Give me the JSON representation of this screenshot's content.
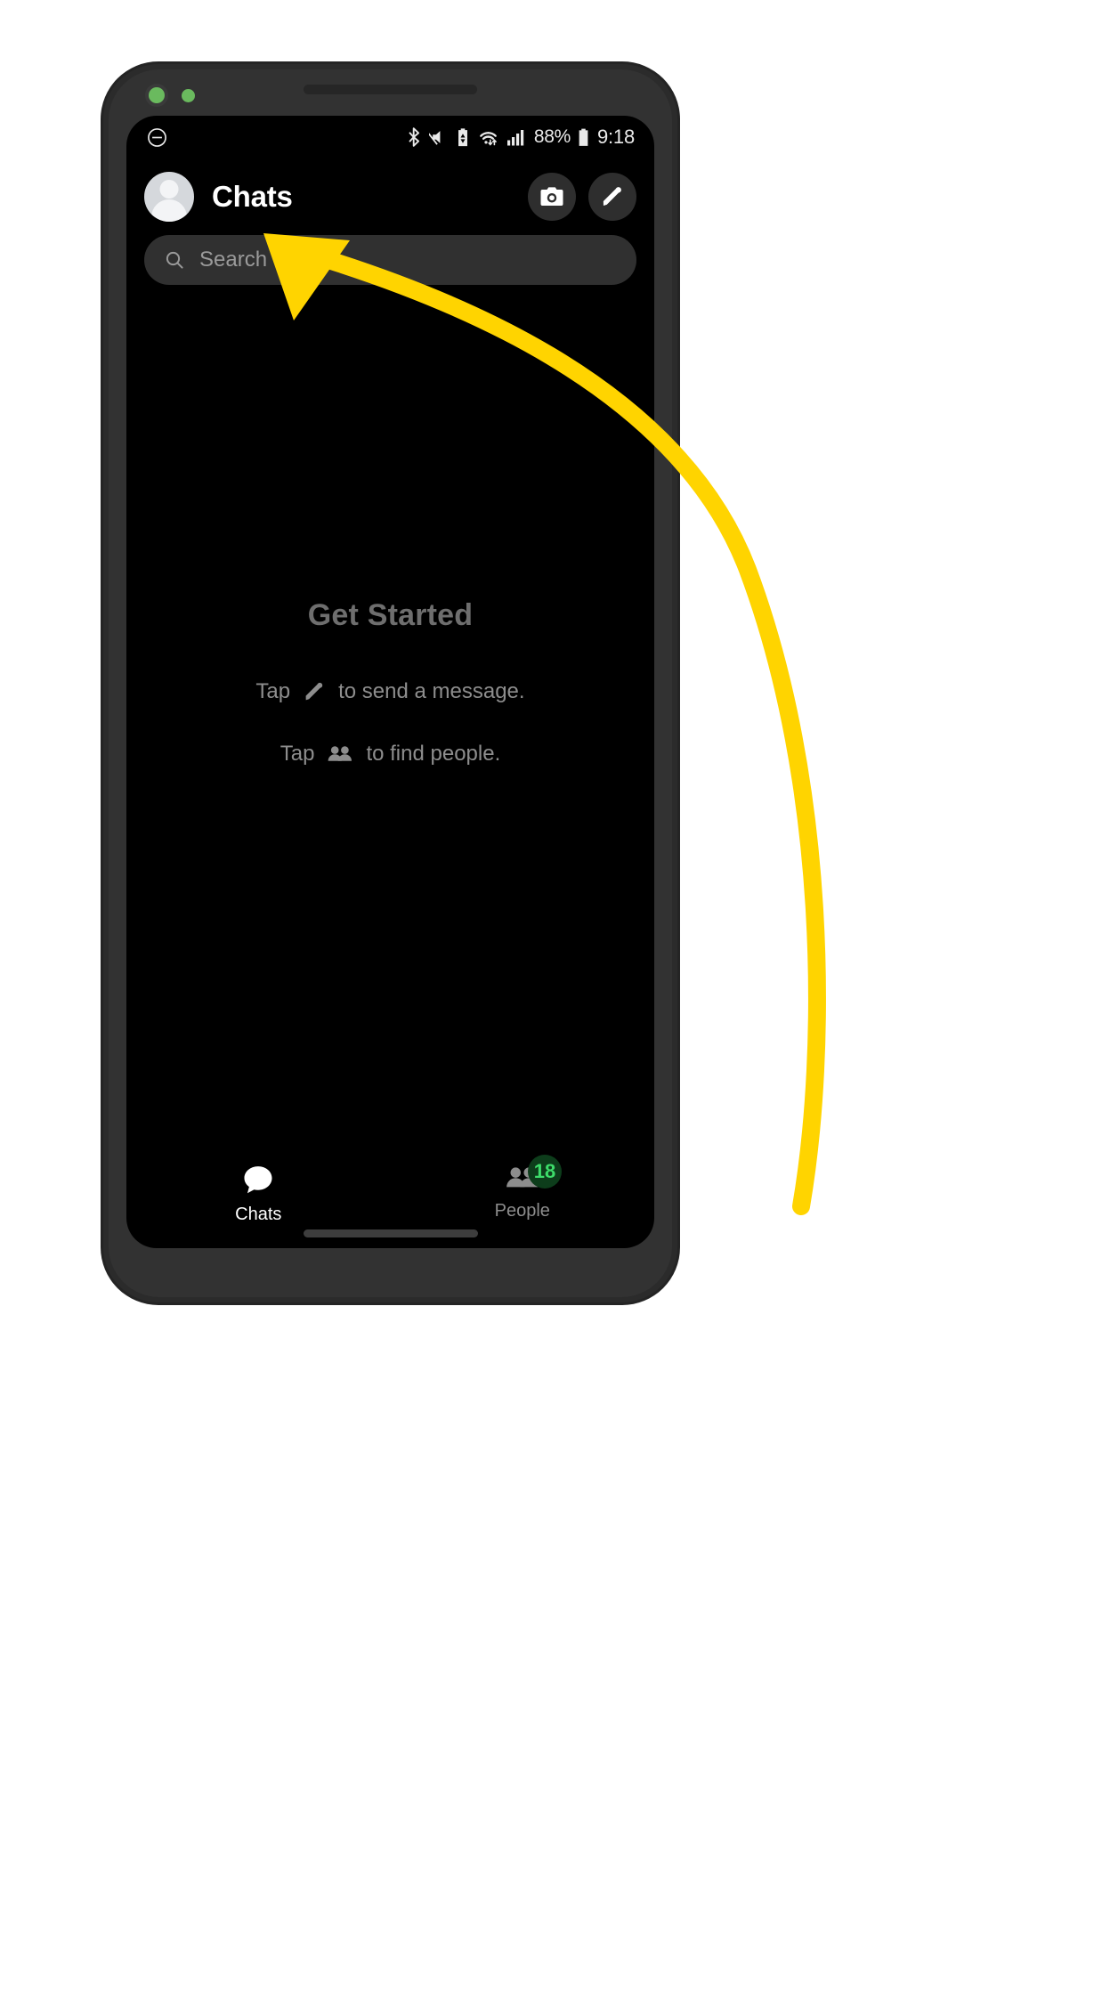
{
  "app": {
    "title": "Chats"
  },
  "status_bar": {
    "dnd_icon": "do-not-disturb-icon",
    "bluetooth_icon": "bluetooth-icon",
    "mute_icon": "volume-off-icon",
    "battery_saver_icon": "battery-saver-icon",
    "wifi_icon": "wifi-data-icon",
    "signal_icon": "cell-signal-icon",
    "battery_percent": "88%",
    "battery_icon": "battery-full-icon",
    "time": "9:18"
  },
  "header": {
    "avatar_name": "profile-avatar",
    "camera_label": "camera-icon",
    "compose_label": "compose-pencil-icon"
  },
  "search": {
    "placeholder": "Search",
    "icon": "search-icon"
  },
  "empty_state": {
    "title": "Get Started",
    "line1_before": "Tap",
    "line1_icon": "pencil-icon",
    "line1_after": "to send a message.",
    "line2_before": "Tap",
    "line2_icon": "people-icon",
    "line2_after": "to find people."
  },
  "bottom_nav": {
    "items": [
      {
        "label": "Chats",
        "icon": "chat-bubble-icon",
        "active": true,
        "badge": ""
      },
      {
        "label": "People",
        "icon": "people-icon",
        "active": false,
        "badge": "18"
      }
    ]
  },
  "annotation": {
    "arrow_color": "#FFD400",
    "arrow_target": "profile-avatar"
  },
  "colors": {
    "screen_bg": "#000000",
    "device_bg": "#2b2b2b",
    "accent_badge_text": "#3ddc6a",
    "accent_badge_bg": "#0d3d1b",
    "muted_text": "#8d8d8d"
  }
}
